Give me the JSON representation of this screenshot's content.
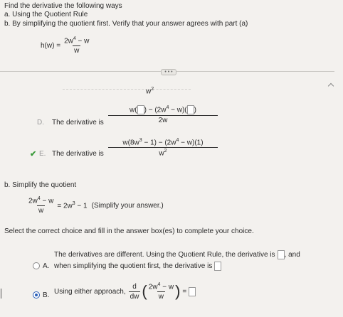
{
  "header": {
    "prompt": "Find the derivative the following ways",
    "part_a": "a. Using the Quotient Rule",
    "part_b": "b. By simplifying the quotient first. Verify that your answer agrees with part (a)"
  },
  "function": {
    "lhs": "h(w) =",
    "numerator": "2w",
    "num_exp": "4",
    "num_tail": " − w",
    "denominator": "w"
  },
  "expand_pill": "• • •",
  "partial_top": "w",
  "partial_top_exp": "2",
  "option_d": {
    "letter": "D.",
    "text": "The derivative is",
    "numerator_a": "w(",
    "numerator_b": ") − (2w",
    "numerator_exp": "4",
    "numerator_c": " − w)(",
    "numerator_d": ")",
    "denominator": "2w"
  },
  "option_e": {
    "letter": "E.",
    "text": "The derivative is",
    "numerator_a": "w(8w",
    "numerator_exp1": "3",
    "numerator_b": " − 1) − (2w",
    "numerator_exp2": "4",
    "numerator_c": " − w)(1)",
    "denominator": "w",
    "den_exp": "2"
  },
  "part_b_section": {
    "label": "b. Simplify the quotient",
    "frac_num": "2w",
    "frac_num_exp": "4",
    "frac_num_tail": " − w",
    "frac_den": "w",
    "result_a": "= 2w",
    "result_exp": "3",
    "result_b": " − 1",
    "note": "(Simplify your answer.)"
  },
  "instruction": "Select the correct choice and fill in the answer box(es) to complete your choice.",
  "choice_a": {
    "letter": "A.",
    "line1": "The derivatives are different. Using the Quotient Rule, the derivative is",
    "and": ", and",
    "line2": "when simplifying the quotient first, the derivative is"
  },
  "choice_b": {
    "letter": "B.",
    "text": "Using either approach,",
    "d_num": "d",
    "d_den": "dw",
    "frac_num": "2w",
    "frac_num_exp": "4",
    "frac_num_tail": " − w",
    "frac_den": "w",
    "equals": "="
  },
  "colors": {
    "check": "#3a9a3a",
    "radio_selected": "#2b5fb8"
  }
}
